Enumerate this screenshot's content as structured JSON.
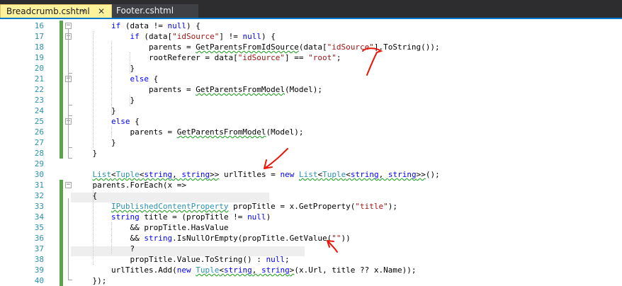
{
  "tabs": [
    {
      "label": "Breadcrumb.cshtml",
      "active": true,
      "pin_glyph": "⊣",
      "close_glyph": "✕"
    },
    {
      "label": "Footer.cshtml",
      "active": false
    }
  ],
  "colors": {
    "keyword": "#0000ff",
    "string": "#a31515",
    "type": "#2b91af",
    "line_number": "#2b91af",
    "changed_margin": "#57a64a",
    "squiggle": "#2fa82f",
    "annotation": "#e8170a",
    "active_tab": "#fff29d",
    "tab_accent": "#007acc"
  },
  "icons": [
    "pin-icon",
    "close-icon",
    "collapse-icon"
  ],
  "lines": [
    {
      "num": "16",
      "segs": [
        {
          "t": "        "
        },
        {
          "t": "if",
          "c": "kw"
        },
        {
          "t": " (data != "
        },
        {
          "t": "null",
          "c": "kw"
        },
        {
          "t": ") {"
        }
      ]
    },
    {
      "num": "17",
      "segs": [
        {
          "t": "            "
        },
        {
          "t": "if",
          "c": "kw"
        },
        {
          "t": " (data["
        },
        {
          "t": "\"idSource\"",
          "c": "str"
        },
        {
          "t": "] != "
        },
        {
          "t": "null",
          "c": "kw"
        },
        {
          "t": ") {"
        }
      ]
    },
    {
      "num": "18",
      "segs": [
        {
          "t": "                parents = "
        },
        {
          "t": "GetParentsFromIdSource",
          "sq": true
        },
        {
          "t": "(data["
        },
        {
          "t": "\"idSource\"",
          "c": "str"
        },
        {
          "t": "].ToString());"
        }
      ]
    },
    {
      "num": "19",
      "segs": [
        {
          "t": "                rootReferer = data["
        },
        {
          "t": "\"idSource\"",
          "c": "str"
        },
        {
          "t": "] == "
        },
        {
          "t": "\"root\"",
          "c": "str"
        },
        {
          "t": ";"
        }
      ]
    },
    {
      "num": "20",
      "segs": [
        {
          "t": "            }"
        }
      ]
    },
    {
      "num": "21",
      "segs": [
        {
          "t": "            "
        },
        {
          "t": "else",
          "c": "kw"
        },
        {
          "t": " {"
        }
      ]
    },
    {
      "num": "22",
      "segs": [
        {
          "t": "                parents = "
        },
        {
          "t": "GetParentsFromModel",
          "sq": true
        },
        {
          "t": "(Model);"
        }
      ]
    },
    {
      "num": "23",
      "segs": [
        {
          "t": "            }"
        }
      ]
    },
    {
      "num": "24",
      "segs": [
        {
          "t": "        }"
        }
      ]
    },
    {
      "num": "25",
      "segs": [
        {
          "t": "        "
        },
        {
          "t": "else",
          "c": "kw"
        },
        {
          "t": " {"
        }
      ]
    },
    {
      "num": "26",
      "segs": [
        {
          "t": "            parents = "
        },
        {
          "t": "GetParentsFromModel",
          "sq": true
        },
        {
          "t": "(Model);"
        }
      ]
    },
    {
      "num": "27",
      "segs": [
        {
          "t": "        }"
        }
      ]
    },
    {
      "num": "28",
      "segs": [
        {
          "t": "    }"
        }
      ]
    },
    {
      "num": "29",
      "segs": [
        {
          "t": ""
        }
      ]
    },
    {
      "num": "30",
      "segs": [
        {
          "t": "    "
        },
        {
          "t": "List",
          "c": "type",
          "sq": true
        },
        {
          "t": "<",
          "sq": true
        },
        {
          "t": "Tuple",
          "c": "type",
          "sq": true
        },
        {
          "t": "<",
          "sq": true
        },
        {
          "t": "string",
          "c": "kw",
          "sq": true
        },
        {
          "t": ", ",
          "sq": true
        },
        {
          "t": "string",
          "c": "kw",
          "sq": true
        },
        {
          "t": ">>",
          "sq": true
        },
        {
          "t": " urlTitles = "
        },
        {
          "t": "new",
          "c": "kw"
        },
        {
          "t": " "
        },
        {
          "t": "List",
          "c": "type",
          "sq": true
        },
        {
          "t": "<",
          "sq": true
        },
        {
          "t": "Tuple",
          "c": "type",
          "sq": true
        },
        {
          "t": "<",
          "sq": true
        },
        {
          "t": "string",
          "c": "kw",
          "sq": true
        },
        {
          "t": ", ",
          "sq": true
        },
        {
          "t": "string",
          "c": "kw",
          "sq": true
        },
        {
          "t": ">>",
          "sq": true
        },
        {
          "t": "();"
        }
      ]
    },
    {
      "num": "31",
      "segs": [
        {
          "t": "    parents.ForEach(x =>"
        }
      ]
    },
    {
      "num": "32",
      "segs": [
        {
          "t": "    {"
        }
      ]
    },
    {
      "num": "33",
      "segs": [
        {
          "t": "        "
        },
        {
          "t": "IPublishedContentProperty",
          "c": "type",
          "sq": true
        },
        {
          "t": " propTitle = x.GetProperty("
        },
        {
          "t": "\"title\"",
          "c": "str"
        },
        {
          "t": ");"
        }
      ]
    },
    {
      "num": "34",
      "segs": [
        {
          "t": "        "
        },
        {
          "t": "string",
          "c": "kw"
        },
        {
          "t": " title = (propTitle != "
        },
        {
          "t": "null",
          "c": "kw"
        },
        {
          "t": ")"
        }
      ]
    },
    {
      "num": "35",
      "segs": [
        {
          "t": "            && propTitle.HasValue"
        }
      ]
    },
    {
      "num": "36",
      "segs": [
        {
          "t": "            && "
        },
        {
          "t": "string",
          "c": "kw"
        },
        {
          "t": ".IsNullOrEmpty(propTitle.GetValue("
        },
        {
          "t": "\"\"",
          "c": "str"
        },
        {
          "t": "))"
        }
      ]
    },
    {
      "num": "37",
      "segs": [
        {
          "t": "            ?"
        }
      ]
    },
    {
      "num": "38",
      "segs": [
        {
          "t": "            propTitle.Value.ToString() : "
        },
        {
          "t": "null",
          "c": "kw"
        },
        {
          "t": ";"
        }
      ]
    },
    {
      "num": "39",
      "segs": [
        {
          "t": "        urlTitles.Add("
        },
        {
          "t": "new",
          "c": "kw"
        },
        {
          "t": " "
        },
        {
          "t": "Tuple",
          "c": "type",
          "sq": true
        },
        {
          "t": "<",
          "sq": true
        },
        {
          "t": "string",
          "c": "kw",
          "sq": true
        },
        {
          "t": ", ",
          "sq": true
        },
        {
          "t": "string",
          "c": "kw",
          "sq": true
        },
        {
          "t": ">",
          "sq": true
        },
        {
          "t": "(x.Url, title ?? x.Name));"
        }
      ]
    },
    {
      "num": "40",
      "segs": [
        {
          "t": "    });"
        }
      ]
    }
  ]
}
